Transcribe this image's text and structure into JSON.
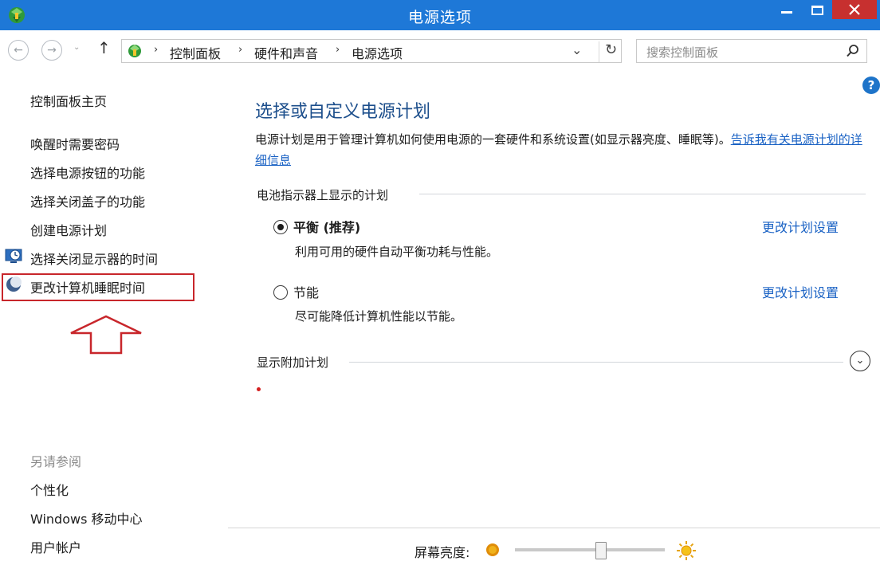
{
  "window": {
    "title": "电源选项"
  },
  "nav": {
    "back_glyph": "←",
    "forward_glyph": "→",
    "history_glyph": "⌄",
    "up_glyph": "↑",
    "breadcrumbs": [
      "控制面板",
      "硬件和声音",
      "电源选项"
    ],
    "separator": "›",
    "dropdown_glyph": "⌄",
    "refresh_glyph": "↻"
  },
  "search": {
    "placeholder": "搜索控制面板"
  },
  "help": {
    "glyph": "?"
  },
  "left_pane": {
    "home_link": "控制面板主页",
    "tasks": [
      "唤醒时需要密码",
      "选择电源按钮的功能",
      "选择关闭盖子的功能",
      "创建电源计划",
      "选择关闭显示器的时间",
      "更改计算机睡眠时间"
    ],
    "see_also_heading": "另请参阅",
    "see_also": [
      "个性化",
      "Windows 移动中心",
      "用户帐户"
    ]
  },
  "main": {
    "title": "选择或自定义电源计划",
    "description": "电源计划是用于管理计算机如何使用电源的一套硬件和系统设置(如显示器亮度、睡眠等)。",
    "description_link": "告诉我有关电源计划的详细信息",
    "battery_group_heading": "电池指示器上显示的计划",
    "plans": [
      {
        "name": "平衡 (推荐)",
        "description": "利用可用的硬件自动平衡功耗与性能。",
        "selected": true,
        "link": "更改计划设置"
      },
      {
        "name": "节能",
        "description": "尽可能降低计算机性能以节能。",
        "selected": false,
        "link": "更改计划设置"
      }
    ],
    "additional_plans_heading": "显示附加计划",
    "expand_glyph": "⌄"
  },
  "status_bar": {
    "brightness_label": "屏幕亮度:",
    "brightness_level": 0.58
  },
  "colors": {
    "titlebar": "#1e78d7",
    "close_button": "#c7302f",
    "link": "#1a62c4",
    "heading": "#1d4f8c",
    "highlight_box": "#c8262b"
  }
}
